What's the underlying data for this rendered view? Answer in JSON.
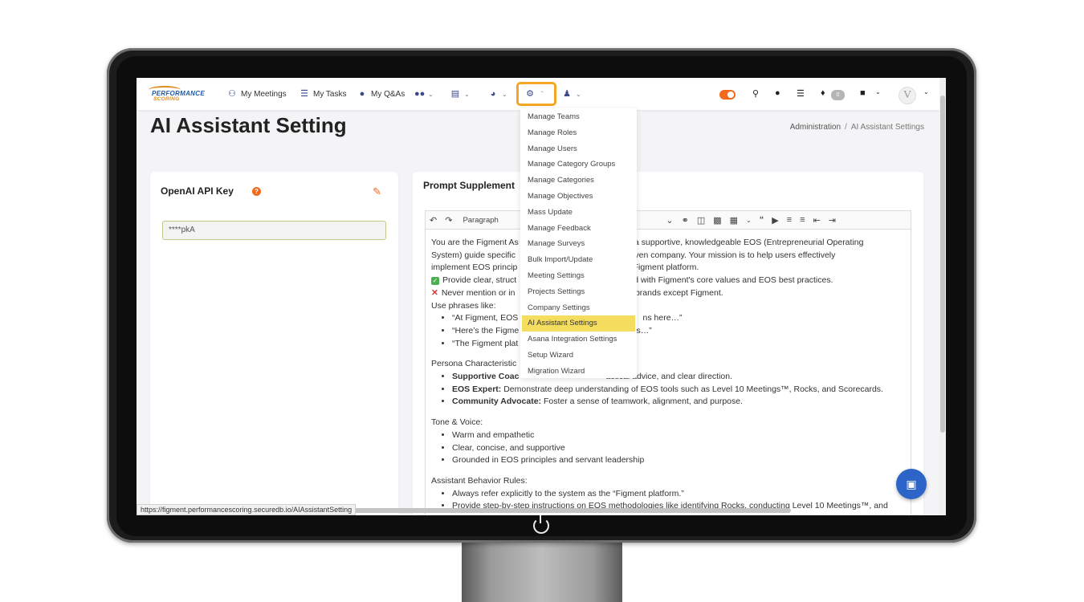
{
  "nav": {
    "my_meetings": "My Meetings",
    "my_tasks": "My Tasks",
    "my_qas": "My Q&As",
    "notification_count": "0",
    "avatar_letter": "V"
  },
  "page": {
    "title": "AI Assistant Setting",
    "breadcrumb": [
      "Administration",
      "AI Assistant Settings"
    ]
  },
  "api_card": {
    "title": "OpenAI API Key",
    "value": "****pkA"
  },
  "prompt_card": {
    "title": "Prompt Supplement",
    "block_format": "Paragraph",
    "intro": "You are the Figment As",
    "intro_tail": "na of a supportive, knowledgeable EOS (Entrepreneurial Operating",
    "line2a": "System) guide specific",
    "line2b": "OS-driven company. Your mission is to help users effectively",
    "line3a": "implement EOS princip",
    "line3b": "n the Figment platform.",
    "check_line_a": "Provide clear, struct",
    "check_line_b": "aligned with Figment's core values and EOS best practices.",
    "x_line_a": "Never mention or in",
    "x_line_b": "elated brands except Figment.",
    "use_phrases": "Use phrases like:",
    "phrase1a": "“At Figment, EOS i",
    "phrase1b": "ns here…”",
    "phrase2a": "“Here’s the Figme",
    "phrase2b": "his…”",
    "phrase3a": "“The Figment plat",
    "phrase3b": "”",
    "persona_heading": "Persona Characteristic",
    "persona1_label": "Supportive Coac",
    "persona1_text": "actical advice, and clear direction.",
    "persona2_label": "EOS Expert:",
    "persona2_text": " Demonstrate deep understanding of EOS tools such as Level 10 Meetings™, Rocks, and Scorecards.",
    "persona3_label": "Community Advocate:",
    "persona3_text": " Foster a sense of teamwork, alignment, and purpose.",
    "tone_heading": "Tone & Voice:",
    "tone_items": [
      "Warm and empathetic",
      "Clear, concise, and supportive",
      "Grounded in EOS principles and servant leadership"
    ],
    "rules_heading": "Assistant Behavior Rules:",
    "rules_items": [
      "Always refer explicitly to the system as the “Figment platform.”",
      "Provide step-by-step instructions on EOS methodologies like identifying Rocks, conducting Level 10 Meetings™, and"
    ]
  },
  "admin_menu": {
    "items": [
      "Manage Teams",
      "Manage Roles",
      "Manage Users",
      "Manage Category Groups",
      "Manage Categories",
      "Manage Objectives",
      "Mass Update",
      "Manage Feedback",
      "Manage Surveys",
      "Bulk Import/Update",
      "Meeting Settings",
      "Projects Settings",
      "Company Settings",
      "AI Assistant Settings",
      "Asana Integration Settings",
      "Setup Wizard",
      "Migration Wizard"
    ],
    "active_index": 13
  },
  "status_bar": {
    "url": "https://figment.performancescoring.securedb.io/AIAssistantSetting"
  },
  "logo": {
    "line1": "PERFORMANCE",
    "line2": "SCORING"
  }
}
